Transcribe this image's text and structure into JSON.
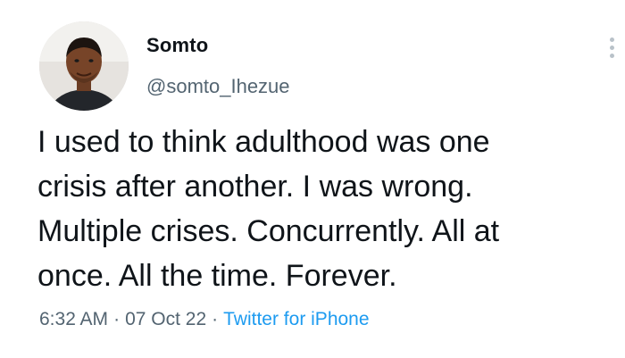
{
  "tweet": {
    "author": {
      "display_name": "Somto",
      "handle": "@somto_Ihezue"
    },
    "text": "I used to think adulthood was one\ncrisis after another. I was wrong.\nMultiple crises. Concurrently. All at\nonce. All the time. Forever.",
    "time": "6:32 AM",
    "date": "07 Oct 22",
    "source": "Twitter for iPhone",
    "separator": "·"
  },
  "colors": {
    "text": "#0f1419",
    "secondary": "#536471",
    "link": "#1d9bf0"
  },
  "icons": {
    "more": "more-dots-icon",
    "avatar": "avatar"
  }
}
